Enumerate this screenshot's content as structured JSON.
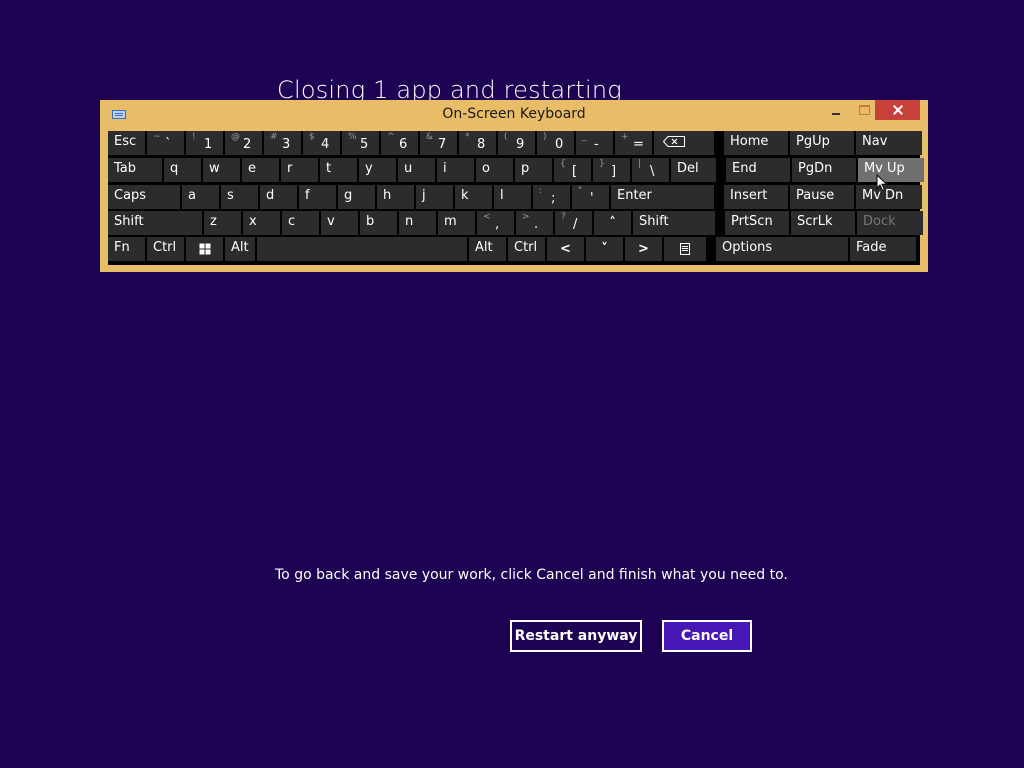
{
  "screen": {
    "title": "Closing 1 app and restarting",
    "message": "To go back and save your work, click Cancel and finish what you need to.",
    "buttons": {
      "restart": "Restart anyway",
      "cancel": "Cancel"
    },
    "colors": {
      "background": "#1d0254",
      "cancel_button": "#4617b4",
      "osk_frame": "#e9bd68",
      "osk_close": "#c7403a",
      "key": "#2c2c2c",
      "key_highlight": "#707070"
    }
  },
  "osk": {
    "title": "On-Screen Keyboard",
    "window_controls": [
      "minimize-icon",
      "maximize-icon",
      "close-icon"
    ],
    "rows": {
      "r1": [
        "Esc",
        "~ `",
        "! 1",
        "@ 2",
        "# 3",
        "$ 4",
        "% 5",
        "^ 6",
        "& 7",
        "* 8",
        "( 9",
        ") 0",
        "_ -",
        "+ =",
        "backspace-icon",
        "Home",
        "PgUp",
        "Nav"
      ],
      "r2": [
        "Tab",
        "q",
        "w",
        "e",
        "r",
        "t",
        "y",
        "u",
        "i",
        "o",
        "p",
        "{ [",
        "} ]",
        "| \\",
        "Del",
        "End",
        "PgDn",
        "Mv Up"
      ],
      "r3": [
        "Caps",
        "a",
        "s",
        "d",
        "f",
        "g",
        "h",
        "j",
        "k",
        "l",
        ": ;",
        "\" '",
        "Enter",
        "Insert",
        "Pause",
        "Mv Dn"
      ],
      "r4": [
        "Shift",
        "z",
        "x",
        "c",
        "v",
        "b",
        "n",
        "m",
        "< ,",
        "> .",
        "? /",
        "up-arrow-icon",
        "Shift",
        "PrtScn",
        "ScrLk",
        "Dock"
      ],
      "r5": [
        "Fn",
        "Ctrl",
        "windows-icon",
        "Alt",
        "space",
        "Alt",
        "Ctrl",
        "left-arrow-icon",
        "down-arrow-icon",
        "right-arrow-icon",
        "menu-icon",
        "Options",
        "Fade"
      ]
    },
    "highlighted_key": "Mv Up",
    "disabled_key": "Dock"
  }
}
